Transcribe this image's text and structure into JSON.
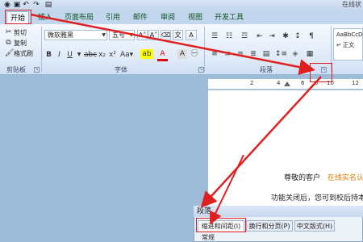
{
  "titlebar": {
    "right_title": "在线状",
    "undo_icon": "undo-icon",
    "redo_icon": "redo-icon"
  },
  "tabs": [
    "开始",
    "插入",
    "页面布局",
    "引用",
    "邮件",
    "审阅",
    "视图",
    "开发工具"
  ],
  "clipboard": {
    "cut": "剪切",
    "copy": "复制",
    "format_painter": "格式刷",
    "group_label": "剪贴板"
  },
  "font": {
    "font_name": "微软雅黑",
    "font_size": "五号",
    "group_label": "字体"
  },
  "paragraph": {
    "group_label": "段落"
  },
  "styles": {
    "preview": "AaBbCcDd",
    "name": "↵ 正文"
  },
  "ruler": {
    "numbers": [
      "2",
      "4",
      "6",
      "8",
      "10",
      "12"
    ]
  },
  "document": {
    "line1_prefix": "尊敬的客户",
    "line1_highlight": "在线实名认",
    "line2": "功能关闭后，您可到校后持本"
  },
  "dialog": {
    "title": "段落",
    "tabs": [
      "缩进和间距(I)",
      "换行和分页(P)",
      "中文版式(H)"
    ],
    "section": "常规"
  },
  "colors": {
    "annotation": "#e02020",
    "highlight_text": "#e07b00",
    "ribbon": "#dfeaf8"
  }
}
